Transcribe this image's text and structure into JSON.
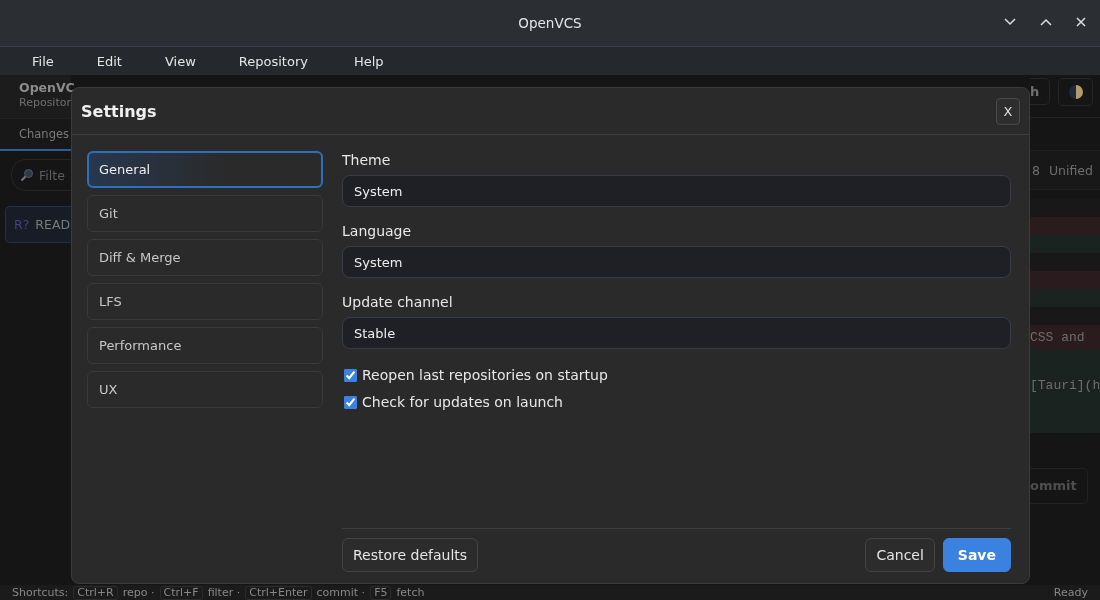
{
  "window": {
    "title": "OpenVCS"
  },
  "menu": [
    "File",
    "Edit",
    "View",
    "Repository",
    "Help"
  ],
  "background": {
    "app_name": "OpenVC",
    "subtitle": "Repositor",
    "tabs": [
      {
        "label": "Changes",
        "selected": true
      }
    ],
    "filter": {
      "placeholder": "Filte"
    },
    "files": [
      {
        "status": "R?",
        "name": "READ",
        "selected": true
      }
    ],
    "toolbar_button": "h",
    "diff_header": {
      "count": "8",
      "mode": "Unified"
    },
    "diff_lines": [
      {
        "kind": "context"
      },
      {
        "kind": "removed"
      },
      {
        "kind": "added"
      },
      {
        "kind": "context"
      },
      {
        "kind": "removed"
      },
      {
        "kind": "added"
      },
      {
        "kind": "context"
      },
      {
        "kind": "removed",
        "text": "CSS and"
      },
      {
        "kind": "added"
      },
      {
        "kind": "added",
        "text": "[Tauri](h"
      },
      {
        "kind": "added"
      }
    ],
    "commit_button": "ommit"
  },
  "dialog": {
    "title": "Settings",
    "close": "X",
    "nav": [
      {
        "label": "General",
        "selected": true
      },
      {
        "label": "Git",
        "selected": false
      },
      {
        "label": "Diff & Merge",
        "selected": false
      },
      {
        "label": "LFS",
        "selected": false
      },
      {
        "label": "Performance",
        "selected": false
      },
      {
        "label": "UX",
        "selected": false
      }
    ],
    "fields": [
      {
        "label": "Theme",
        "value": "System"
      },
      {
        "label": "Language",
        "value": "System"
      },
      {
        "label": "Update channel",
        "value": "Stable"
      }
    ],
    "options": [
      {
        "label": "Reopen last repositories on startup",
        "checked": true
      },
      {
        "label": "Check for updates on launch",
        "checked": true
      }
    ],
    "buttons": {
      "restore": "Restore defaults",
      "cancel": "Cancel",
      "save": "Save"
    }
  },
  "status_bar": {
    "label": "Shortcuts:",
    "shortcuts": [
      {
        "key": "Ctrl+R",
        "action": "repo ·"
      },
      {
        "key": "Ctrl+F",
        "action": "filter ·"
      },
      {
        "key": "Ctrl+Enter",
        "action": "commit ·"
      },
      {
        "key": "F5",
        "action": "fetch"
      }
    ],
    "status": "Ready"
  }
}
